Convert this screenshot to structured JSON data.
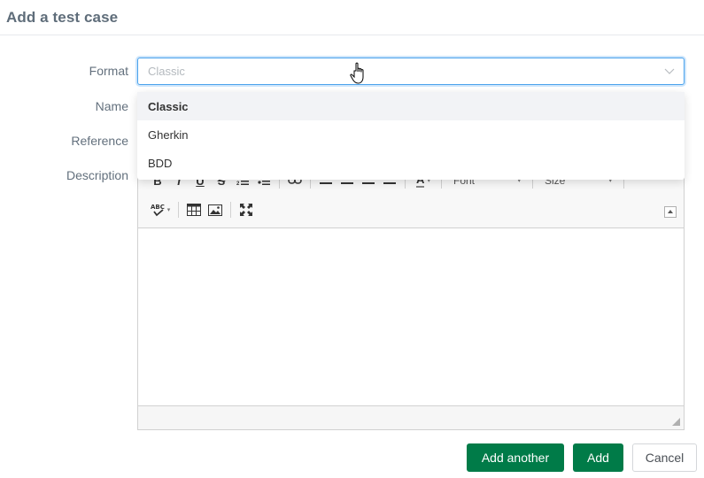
{
  "dialog": {
    "title": "Add a test case"
  },
  "form": {
    "labels": {
      "format": "Format",
      "name": "Name",
      "reference": "Reference",
      "description": "Description"
    },
    "format_select": {
      "placeholder": "Classic",
      "icon": "chevron-down-icon",
      "focus_color": "#4aa3ec",
      "options": [
        {
          "label": "Classic",
          "selected": true
        },
        {
          "label": "Gherkin",
          "selected": false
        },
        {
          "label": "BDD",
          "selected": false
        }
      ]
    },
    "editor": {
      "toolbar_row1": [
        "bold",
        "italic",
        "underline",
        "strikethrough",
        "numbered-list",
        "bulleted-list",
        "link",
        "align-left",
        "align-center",
        "align-right",
        "justify",
        "text-color"
      ],
      "font_combo": "Font",
      "size_combo": "Size",
      "toolbar_row2": [
        "spellcheck",
        "table",
        "image",
        "maximize"
      ],
      "toolbar_glyphs": {
        "bold": "B",
        "italic": "I",
        "underline": "U",
        "strikethrough": "S",
        "text_color": "A",
        "spellcheck": "ABC"
      }
    }
  },
  "buttons": {
    "add_another": "Add another",
    "add": "Add",
    "cancel": "Cancel"
  },
  "colors": {
    "primary": "#007b48",
    "label": "#63707d",
    "title": "#5f6d7a"
  }
}
